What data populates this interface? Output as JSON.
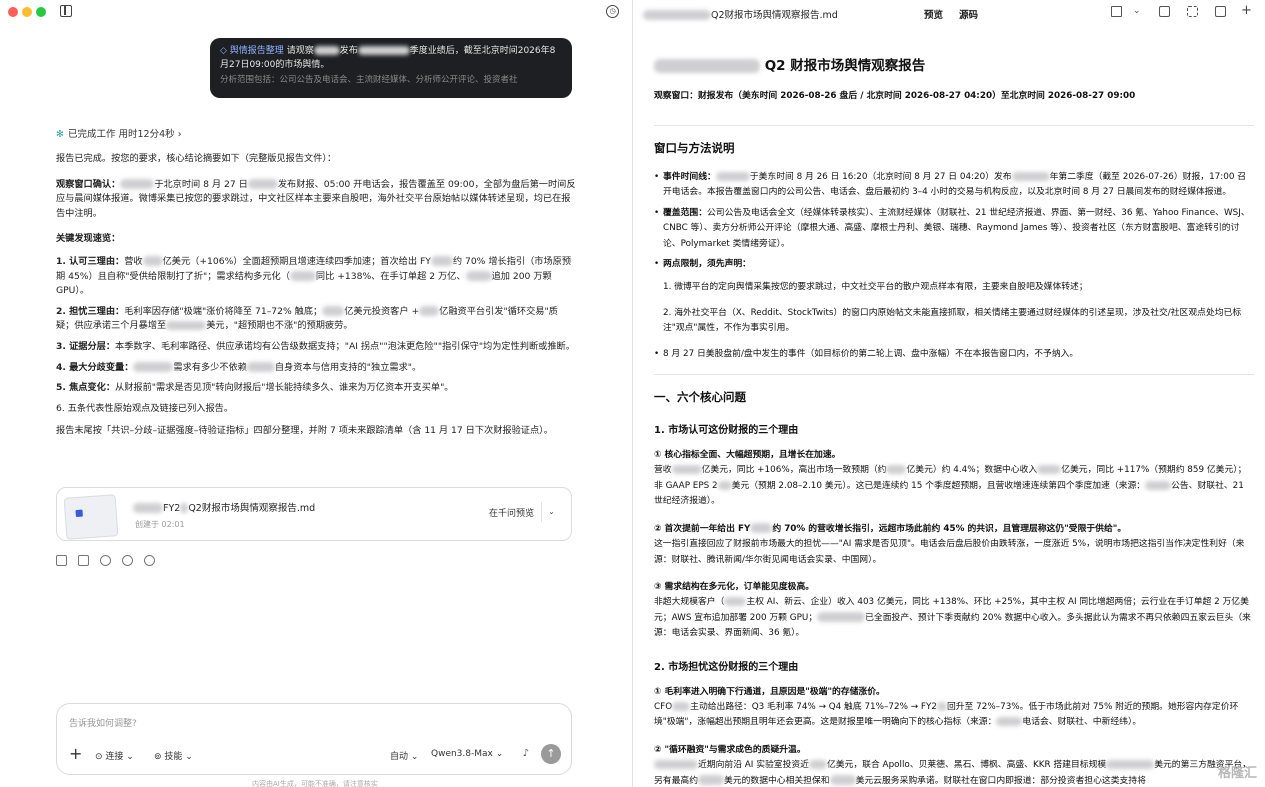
{
  "left": {
    "user_message": {
      "tag": "舆情报告整理",
      "text_a": "请观察",
      "text_b": "发布",
      "text_c": "季度业绩后，截至北京时间2026年8月27日09:00的市场舆情。",
      "scope": "分析范围包括：公司公告及电话会、主流财经媒体、分析师公开评论、投资者社"
    },
    "status": {
      "label": "已完成工作",
      "duration": "用时12分4秒",
      "chevron": "›"
    },
    "intro": "报告已完成。按您的要求，核心结论摘要如下（完整版见报告文件）：",
    "window_label": "观察窗口确认：",
    "window_text_a": "于北京时间 8 月 27 日",
    "window_text_b": "发布财报、05:00 开电话会，报告覆盖至 09:00，全部为盘后第一时间反应与晨间媒体报道。微博采集已按您的要求跳过，中文社区样本主要来自股吧，海外社交平台原始帖以媒体转述呈现，均已在报告中注明。",
    "findings_heading": "关键发现速览：",
    "findings": [
      {
        "label": "1. 认可三理由：",
        "a": "营收",
        "b": "亿美元（+106%）全面超预期且增速连续四季加速；首次给出 FY",
        "c": "约 70% 增长指引（市场原预期 45%）且自称\"受供给限制打了折\"；需求结构多元化（",
        "d": "同比 +138%、在手订单超 2 万亿、",
        "e": "追加 200 万颗 GPU）。"
      },
      {
        "label": "2. 担忧三理由：",
        "a": "毛利率因存储\"极端\"涨价将降至 71–72% 触底；",
        "b": "亿美元投资客户 +",
        "c": "亿融资平台引发\"循环交易\"质疑；供应承诺三个月暴增至",
        "d": "美元，\"超预期也不涨\"的预期疲劳。"
      },
      {
        "label": "3. 证据分层：",
        "a": "本季数字、毛利率路径、供应承诺均有公告级数据支持；\"AI 拐点\"\"泡沫更危险\"\"指引保守\"均为定性判断或推断。"
      },
      {
        "label": "4. 最大分歧变量：",
        "a": "需求有多少不依赖",
        "b": "自身资本与信用支持的\"独立需求\"。"
      },
      {
        "label": "5. 焦点变化：",
        "a": "从财报前\"需求是否见顶\"转向财报后\"增长能持续多久、谁来为万亿资本开支买单\"。"
      },
      {
        "label": "6. ",
        "a": "五条代表性原始观点及链接已列入报告。"
      }
    ],
    "closing": "报告末尾按「共识–分歧–证据强度–待验证指标」四部分整理，并附 7 项未来跟踪清单（含 11 月 17 日下次财报验证点）。",
    "file_card": {
      "name_a": "FY2",
      "name_b": "Q2财报市场舆情观察报告.md",
      "date": "创建于 02:01",
      "preview": "在千问预览",
      "dropdown": "⌄"
    },
    "composer": {
      "placeholder": "告诉我如何调整?",
      "plus": "+",
      "tool1": "连接",
      "tool2": "技能",
      "mode": "自动",
      "model": "Qwen3.8-Max",
      "mic": "♪",
      "send": "↑"
    },
    "footer": "内容由AI生成，可能不准确，请注意核实"
  },
  "right": {
    "header": {
      "file": "Q2财报市场舆情观察报告.md",
      "tab_preview": "预览",
      "tab_source": "源码"
    },
    "doc": {
      "title": "Q2 财报市场舆情观察报告",
      "window": "观察窗口：财报发布（美东时间 2026-08-26 盘后 / 北京时间 2026-08-27 04:20）至北京时间 2026-08-27 09:00",
      "sec_method": "窗口与方法说明",
      "bullets": [
        {
          "label": "事件时间线：",
          "text": "于美东时间 8 月 26 日 16:20（北京时间 8 月 27 日 04:20）发布",
          "text2": "年第二季度（截至 2026-07-26）财报，17:00 召开电话会。本报告覆盖窗口内的公司公告、电话会、盘后最初约 3–4 小时的交易与机构反应，以及北京时间 8 月 27 日晨间发布的财经媒体报道。"
        },
        {
          "label": "覆盖范围：",
          "text": "公司公告及电话会全文（经媒体转录核实）、主流财经媒体（财联社、21 世纪经济报道、界面、第一财经、36 氪、Yahoo Finance、WSJ、CNBC 等）、卖方分析师公开评论（摩根大通、高盛、摩根士丹利、美银、瑞穗、Raymond James 等）、投资者社区（东方财富股吧、富途转引的讨论、Polymarket 类情绪旁证）。"
        },
        {
          "label": "两点限制，须先声明：",
          "text": "",
          "sub": [
            "1. 微博平台的定向舆情采集按您的要求跳过，中文社交平台的散户观点样本有限，主要来自股吧及媒体转述；",
            "2. 海外社交平台（X、Reddit、StockTwits）的窗口内原始帖文未能直接抓取，相关情绪主要通过财经媒体的引述呈现，涉及社交/社区观点处均已标注\"观点\"属性，不作为事实引用。"
          ]
        },
        {
          "label": "",
          "text": "8 月 27 日美股盘前/盘中发生的事件（如目标价的第二轮上调、盘中涨幅）不在本报告窗口内，不予纳入。",
          "bold_text": true
        }
      ],
      "sec_six": "一、六个核心问题",
      "q1": "1. 市场认可这份财报的三个理由",
      "r1_title": "① 核心指标全面、大幅超预期，且增长在加速。",
      "r1_text_a": "营收",
      "r1_text_b": "亿美元，同比 +106%，高出市场一致预期（约",
      "r1_text_c": "亿美元）约 4.4%；数据中心收入",
      "r1_text_d": "亿美元，同比 +117%（预期约 859 亿美元）；非 GAAP EPS 2",
      "r1_text_e": "美元（预期 2.08–2.10 美元）。这已是连续约 15 个季度超预期，且营收增速连续第四个季度加速（来源：",
      "r1_text_f": "公告、财联社、21 世纪经济报道）。",
      "r2_title_a": "② 首次提前一年给出 FY",
      "r2_title_b": "约 70% 的营收增长指引，远超市场此前约 45% 的共识，且管理层称这仍\"受限于供给\"。",
      "r2_text": "这一指引直接回应了财报前市场最大的担忧——\"AI 需求是否见顶\"。电话会后盘后股价由跌转涨，一度涨近 5%，说明市场把这指引当作决定性利好（来源：财联社、腾讯新闻/华尔街见闻电话会实录、中国网）。",
      "r3_title": "③ 需求结构在多元化，订单能见度极高。",
      "r3_text_a": "非超大规模客户（",
      "r3_text_b": "主权 AI、新云、企业）收入 403 亿美元，同比 +138%、环比 +25%，其中主权 AI 同比增超两倍；云行业在手订单超 2 万亿美元；AWS 宣布追加部署 200 万颗 GPU；",
      "r3_text_c": "已全面投产、预计下季贡献约 20% 数据中心收入。多头据此认为需求不再只依赖四五家云巨头（来源：电话会实录、界面新闻、36 氪）。",
      "q2": "2. 市场担忧这份财报的三个理由",
      "w1_title": "① 毛利率进入明确下行通道，且原因是\"极端\"的存储涨价。",
      "w1_text_a": "CFO",
      "w1_text_b": "主动给出路径：Q3 毛利率 74% → Q4 触底 71%–72% → FY2",
      "w1_text_c": "回升至 72%–73%。低于市场此前对 75% 附近的预期。她形容内存定价环境\"极端\"，涨幅超出预期且明年还会更高。这是财报里唯一明确向下的核心指标（来源：",
      "w1_text_d": "电话会、财联社、中新经纬）。",
      "w2_title": "② \"循环融资\"与需求成色的质疑升温。",
      "w2_text_a": "近期向前沿 AI 实验室投资近",
      "w2_text_b": "亿美元，联合 Apollo、贝莱德、黑石、博枫、高盛、KKR 搭建目标规模",
      "w2_text_c": "美元的第三方融资平台，另有最高约",
      "w2_text_d": "美元的数据中心相关担保和",
      "w2_text_e": "美元云服务采购承诺。财联社在窗口内即报道：部分投资者担心这类支持将"
    },
    "watermark": "格隆汇"
  }
}
